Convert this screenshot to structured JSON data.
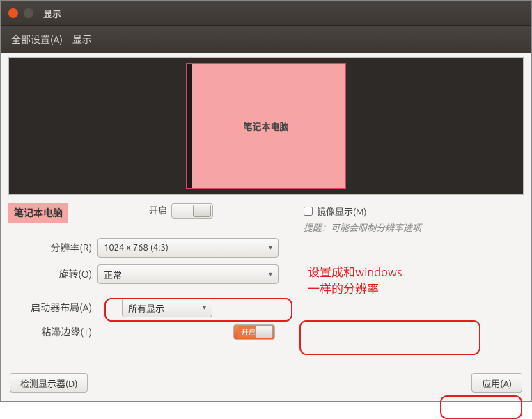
{
  "window": {
    "title": "显示"
  },
  "toolbar": {
    "all_settings": "全部设置(A)",
    "display": "显示"
  },
  "preview": {
    "monitor_label": "笔记本电脑"
  },
  "display_badge": "笔记本电脑",
  "center_switch": {
    "label": "开启"
  },
  "mirror": {
    "label": "镜像显示(M)",
    "hint": "提醒：可能会限制分辨率选项"
  },
  "form": {
    "resolution": {
      "label": "分辨率(R)",
      "value": "1024 x 768 (4:3)"
    },
    "rotation": {
      "label": "旋转(O)",
      "value": "正常"
    },
    "launcher": {
      "label": "启动器布局(A)",
      "value": "所有显示"
    },
    "sticky": {
      "label": "粘滞边缘(T)",
      "switch_text": "开启"
    }
  },
  "annotation": {
    "line1": "设置成和windows",
    "line2": "一样的分辨率"
  },
  "buttons": {
    "detect": "检测显示器(D)",
    "apply": "应用(A)"
  }
}
